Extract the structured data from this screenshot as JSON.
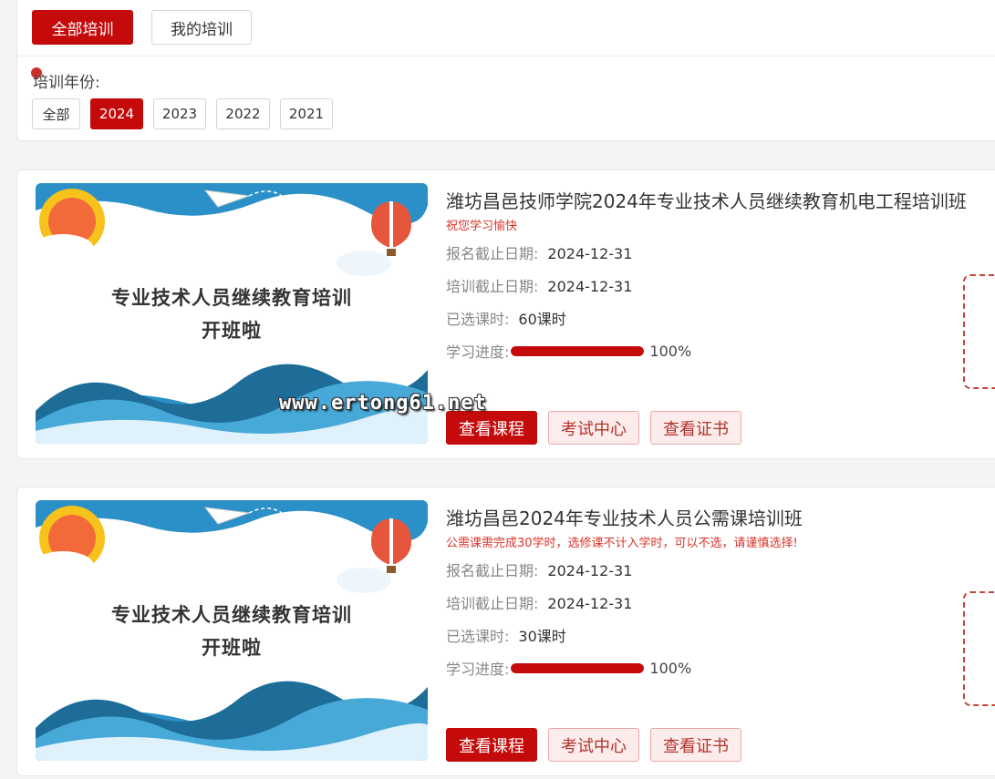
{
  "tabs": [
    {
      "label": "全部培训",
      "active": true
    },
    {
      "label": "我的培训",
      "active": false
    }
  ],
  "year_filter": {
    "label": "培训年份:",
    "options": [
      {
        "label": "全部",
        "active": false
      },
      {
        "label": "2024",
        "active": true
      },
      {
        "label": "2023",
        "active": false
      },
      {
        "label": "2022",
        "active": false
      },
      {
        "label": "2021",
        "active": false
      }
    ]
  },
  "banner": {
    "line1": "专业技术人员继续教育培训",
    "line2": "开班啦"
  },
  "courses": [
    {
      "title": "潍坊昌邑技师学院2024年专业技术人员继续教育机电工程培训班",
      "note": "祝您学习愉快",
      "signup_label": "报名截止日期:",
      "signup_date": "2024-12-31",
      "train_label": "培训截止日期:",
      "train_date": "2024-12-31",
      "hours_label": "已选课时:",
      "hours": "60课时",
      "progress_label": "学习进度:",
      "progress_text": "100%",
      "progress": 1.0,
      "btn_view": "查看课程",
      "btn_exam": "考试中心",
      "btn_cert": "查看证书"
    },
    {
      "title": "潍坊昌邑2024年专业技术人员公需课培训班",
      "note": "公需课需完成30学时，选修课不计入学时，可以不选，请谨慎选择!",
      "signup_label": "报名截止日期:",
      "signup_date": "2024-12-31",
      "train_label": "培训截止日期:",
      "train_date": "2024-12-31",
      "hours_label": "已选课时:",
      "hours": "30课时",
      "progress_label": "学习进度:",
      "progress_text": "100%",
      "progress": 1.0,
      "btn_view": "查看课程",
      "btn_exam": "考试中心",
      "btn_cert": "查看证书"
    }
  ],
  "watermark": "www.ertong61.net",
  "colors": {
    "accent": "#c40a0a",
    "note": "#d9342b"
  }
}
